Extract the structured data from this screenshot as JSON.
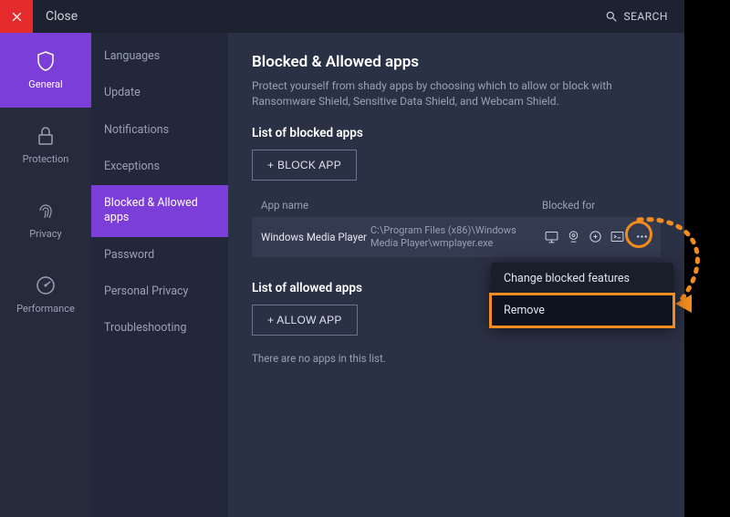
{
  "titlebar": {
    "close_label": "Close",
    "search_label": "SEARCH"
  },
  "nav": {
    "items": [
      {
        "label": "General"
      },
      {
        "label": "Protection"
      },
      {
        "label": "Privacy"
      },
      {
        "label": "Performance"
      }
    ]
  },
  "subnav": {
    "items": [
      {
        "label": "Languages"
      },
      {
        "label": "Update"
      },
      {
        "label": "Notifications"
      },
      {
        "label": "Exceptions"
      },
      {
        "label": "Blocked & Allowed apps"
      },
      {
        "label": "Password"
      },
      {
        "label": "Personal Privacy"
      },
      {
        "label": "Troubleshooting"
      }
    ]
  },
  "main": {
    "title": "Blocked & Allowed apps",
    "description": "Protect yourself from shady apps by choosing which to allow or block with Ransomware Shield, Sensitive Data Shield, and Webcam Shield.",
    "blocked": {
      "heading": "List of blocked apps",
      "button": "+ BLOCK APP",
      "columns": {
        "name": "App name",
        "for": "Blocked for"
      },
      "rows": [
        {
          "name": "Windows Media Player",
          "path": "C:\\Program Files (x86)\\Windows Media Player\\wmplayer.exe"
        }
      ]
    },
    "allowed": {
      "heading": "List of allowed apps",
      "button": "+ ALLOW APP",
      "empty": "There are no apps in this list."
    }
  },
  "popup": {
    "change": "Change blocked features",
    "remove": "Remove"
  },
  "annotation_color": "#f28c1e"
}
